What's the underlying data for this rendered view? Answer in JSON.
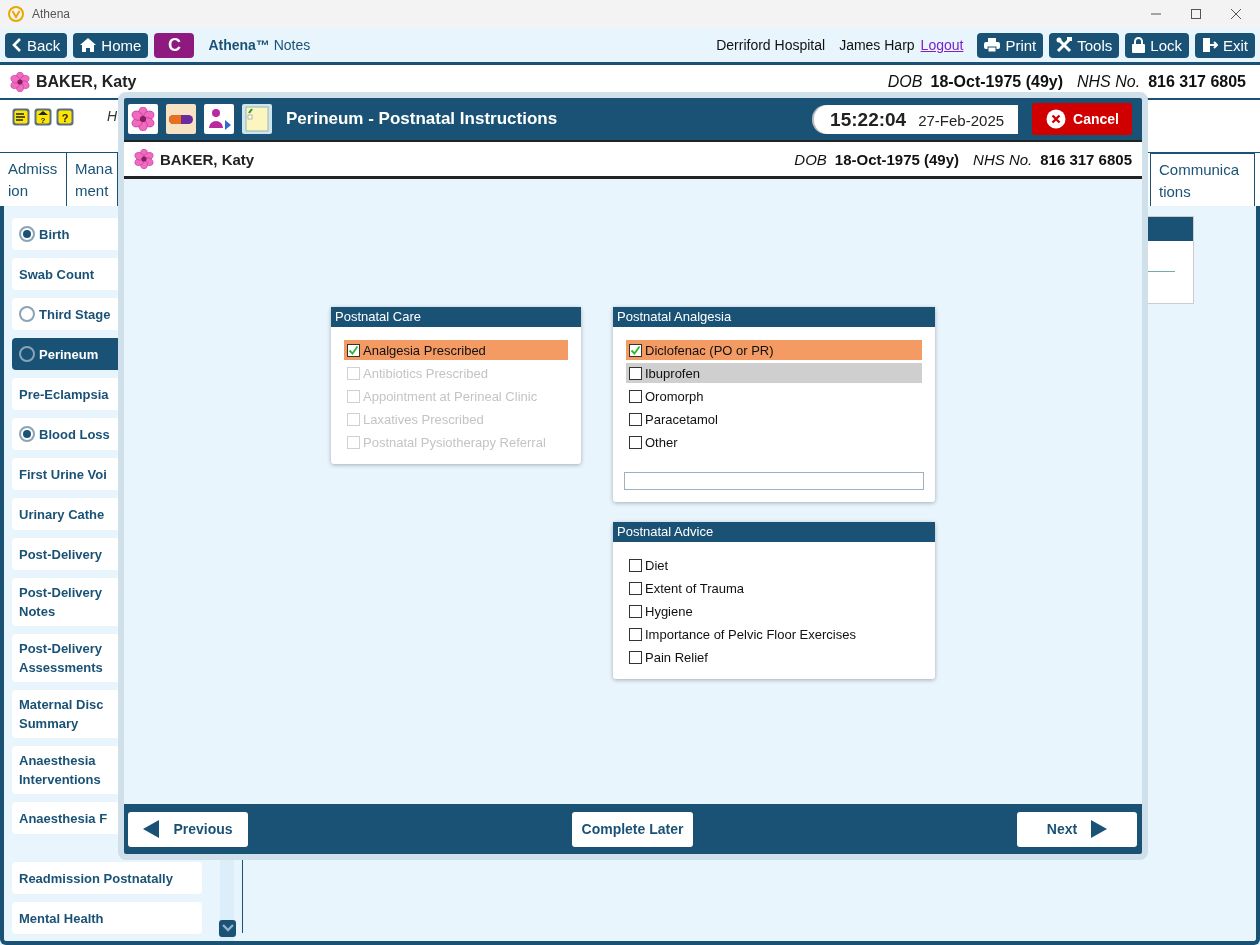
{
  "window": {
    "title": "Athena"
  },
  "toolbar": {
    "nav": [
      {
        "label": "Back",
        "kind": "back"
      },
      {
        "label": "Home",
        "kind": "home"
      }
    ],
    "badge": "C",
    "app_name": "**Athena™** Notes",
    "hospital": "Derriford Hospital",
    "user": "James Harp",
    "logout": "Logout",
    "actions": [
      {
        "label": "Print",
        "kind": "print"
      },
      {
        "label": "Tools",
        "kind": "tools"
      },
      {
        "label": "Lock",
        "kind": "lock"
      },
      {
        "label": "Exit",
        "kind": "exit"
      }
    ]
  },
  "patient": {
    "name": "BAKER, Katy",
    "dob_label": "DOB",
    "dob": "18-Oct-1975 (49y)",
    "nhs_label": "NHS No.",
    "nhs": "816 317 6805"
  },
  "alert_icons": [
    {
      "kind": "hand"
    },
    {
      "kind": "house_help",
      "glyph": "?"
    },
    {
      "kind": "help",
      "glyph": "?"
    }
  ],
  "alert_text": "H",
  "tabs": [
    {
      "label": "Admiss ion",
      "selected": false
    },
    {
      "label": "Mana ment",
      "selected": false
    },
    {
      "label": "Communica tions",
      "selected": false
    }
  ],
  "sidebar": {
    "groups": [
      {
        "items": [
          {
            "label": "Birth",
            "kind": "radio",
            "checked": true,
            "selected": false
          },
          {
            "label": "Swab Count",
            "kind": "plain",
            "selected": false
          },
          {
            "label": "Third Stage",
            "kind": "radio",
            "checked": false,
            "selected": false
          },
          {
            "label": "Perineum",
            "kind": "radio",
            "checked": false,
            "selected": true
          },
          {
            "label": "Pre-Eclampsia",
            "kind": "plain",
            "selected": false
          },
          {
            "label": "Blood Loss",
            "kind": "radio",
            "checked": true,
            "selected": false
          },
          {
            "label": "First Urine Voi",
            "kind": "plain",
            "selected": false
          },
          {
            "label": "Urinary Cathe",
            "kind": "plain",
            "selected": false
          },
          {
            "label": "Post-Delivery",
            "kind": "plain",
            "selected": false
          },
          {
            "label": "Post-Delivery Notes",
            "kind": "plain",
            "selected": false
          },
          {
            "label": "Post-Delivery Assessments",
            "kind": "plain",
            "selected": false
          },
          {
            "label": "Maternal Disc Summary",
            "kind": "plain",
            "selected": false
          },
          {
            "label": "Anaesthesia Interventions",
            "kind": "plain",
            "selected": false
          },
          {
            "label": "Anaesthesia F",
            "kind": "plain",
            "selected": false
          }
        ]
      },
      {
        "items": [
          {
            "label": "Readmission Postnatally",
            "kind": "plain",
            "selected": false
          },
          {
            "label": "Mental Health",
            "kind": "plain",
            "selected": false
          }
        ]
      }
    ]
  },
  "dialog": {
    "title": "Perineum - Postnatal Instructions",
    "time": "15:22:04",
    "date": "27-Feb-2025",
    "cancel": "Cancel",
    "patient": {
      "name": "BAKER, Katy",
      "dob_label": "DOB",
      "dob": "18-Oct-1975 (49y)",
      "nhs_label": "NHS No.",
      "nhs": "816 317 6805"
    },
    "columns": [
      {
        "panels": [
          {
            "title": "Postnatal Care",
            "kind": "plain",
            "items": [
              {
                "label": "Analgesia Prescribed",
                "checked": true,
                "disabled": false,
                "focused": false
              },
              {
                "label": "Antibiotics Prescribed",
                "checked": false,
                "disabled": true,
                "focused": false
              },
              {
                "label": "Appointment at Perineal Clinic",
                "checked": false,
                "disabled": true,
                "focused": false
              },
              {
                "label": "Laxatives Prescribed",
                "checked": false,
                "disabled": true,
                "focused": false
              },
              {
                "label": "Postnatal Pysiotherapy Referral",
                "checked": false,
                "disabled": true,
                "focused": false
              }
            ]
          }
        ]
      },
      {
        "panels": [
          {
            "title": "Postnatal Analgesia",
            "kind": "with_field",
            "items": [
              {
                "label": "Diclofenac (PO or PR)",
                "checked": true,
                "disabled": false,
                "focused": false
              },
              {
                "label": "Ibuprofen",
                "checked": false,
                "disabled": false,
                "focused": true
              },
              {
                "label": "Oromorph",
                "checked": false,
                "disabled": false,
                "focused": false
              },
              {
                "label": "Paracetamol",
                "checked": false,
                "disabled": false,
                "focused": false
              },
              {
                "label": "Other",
                "checked": false,
                "disabled": false,
                "focused": false
              }
            ]
          },
          {
            "title": "Postnatal Advice",
            "kind": "plain",
            "items": [
              {
                "label": "Diet",
                "checked": false,
                "disabled": false,
                "focused": false
              },
              {
                "label": "Extent of Trauma",
                "checked": false,
                "disabled": false,
                "focused": false
              },
              {
                "label": "Hygiene",
                "checked": false,
                "disabled": false,
                "focused": false
              },
              {
                "label": "Importance of Pelvic Floor Exercises",
                "checked": false,
                "disabled": false,
                "focused": false
              },
              {
                "label": "Pain Relief",
                "checked": false,
                "disabled": false,
                "focused": false
              }
            ]
          }
        ]
      }
    ],
    "footer": [
      {
        "label": "Previous",
        "kind": "previous"
      },
      {
        "label": "Complete Later",
        "kind": "plain"
      },
      {
        "label": "Next",
        "kind": "next"
      }
    ]
  }
}
